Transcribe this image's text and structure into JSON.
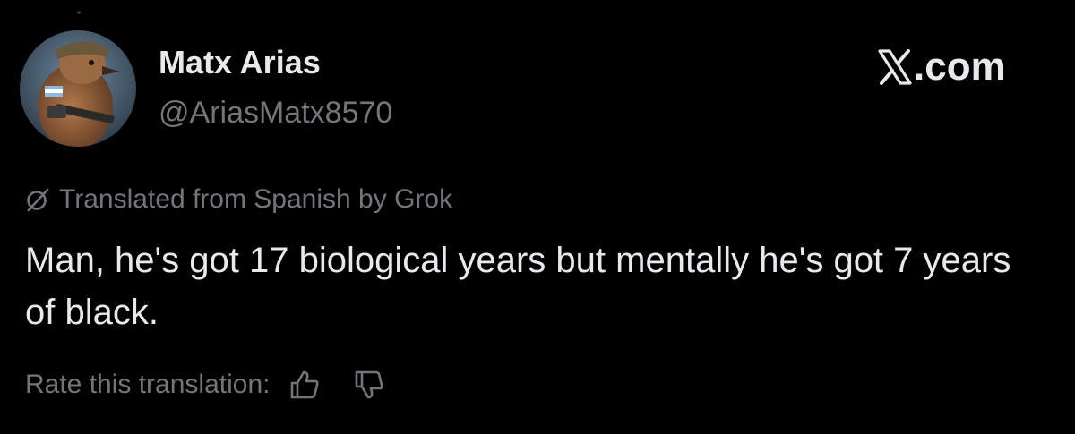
{
  "author": {
    "display_name": "Matx Arias",
    "handle": "@AriasMatx8570",
    "avatar_icon": "bird-soldier-avatar"
  },
  "brand": {
    "label": ".com",
    "logo_icon": "x-logo-icon"
  },
  "translation": {
    "note": "Translated from Spanish by Grok",
    "note_icon": "grok-icon",
    "rate_label": "Rate this translation:",
    "thumbs_up_icon": "thumbs-up-icon",
    "thumbs_down_icon": "thumbs-down-icon"
  },
  "post": {
    "text": "Man, he's got 17 biological years but mentally he's got 7 years of black."
  },
  "colors": {
    "background": "#000000",
    "primary_text": "#e7e9ea",
    "secondary_text": "#71767b"
  }
}
